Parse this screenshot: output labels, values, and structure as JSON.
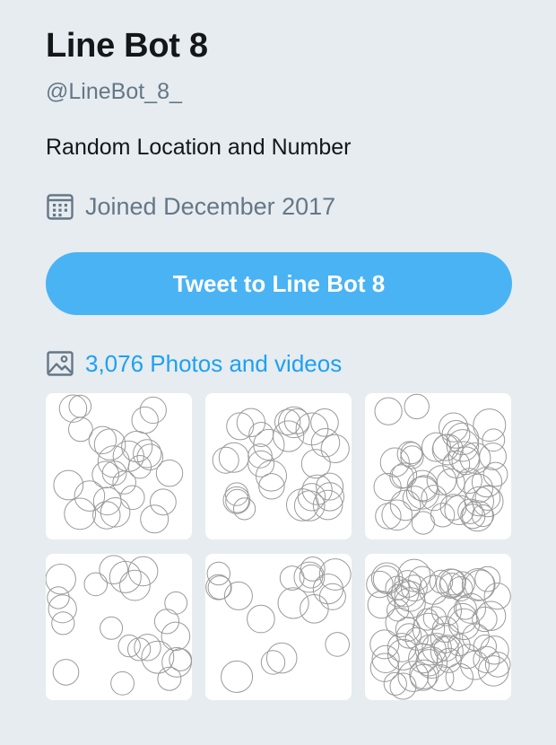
{
  "profile": {
    "name": "Line Bot 8",
    "handle": "@LineBot_8_",
    "bio": "Random Location and Number",
    "joined": "Joined December 2017",
    "joined_icon": "calendar-icon"
  },
  "tweet_button": {
    "label": "Tweet to Line Bot 8"
  },
  "media": {
    "icon": "photo-icon",
    "link_label": "3,076 Photos and videos",
    "thumbnail_count": 6
  },
  "colors": {
    "background": "#e6ecf0",
    "button": "#4ab3f4",
    "link": "#1da1f2",
    "muted": "#657786"
  }
}
